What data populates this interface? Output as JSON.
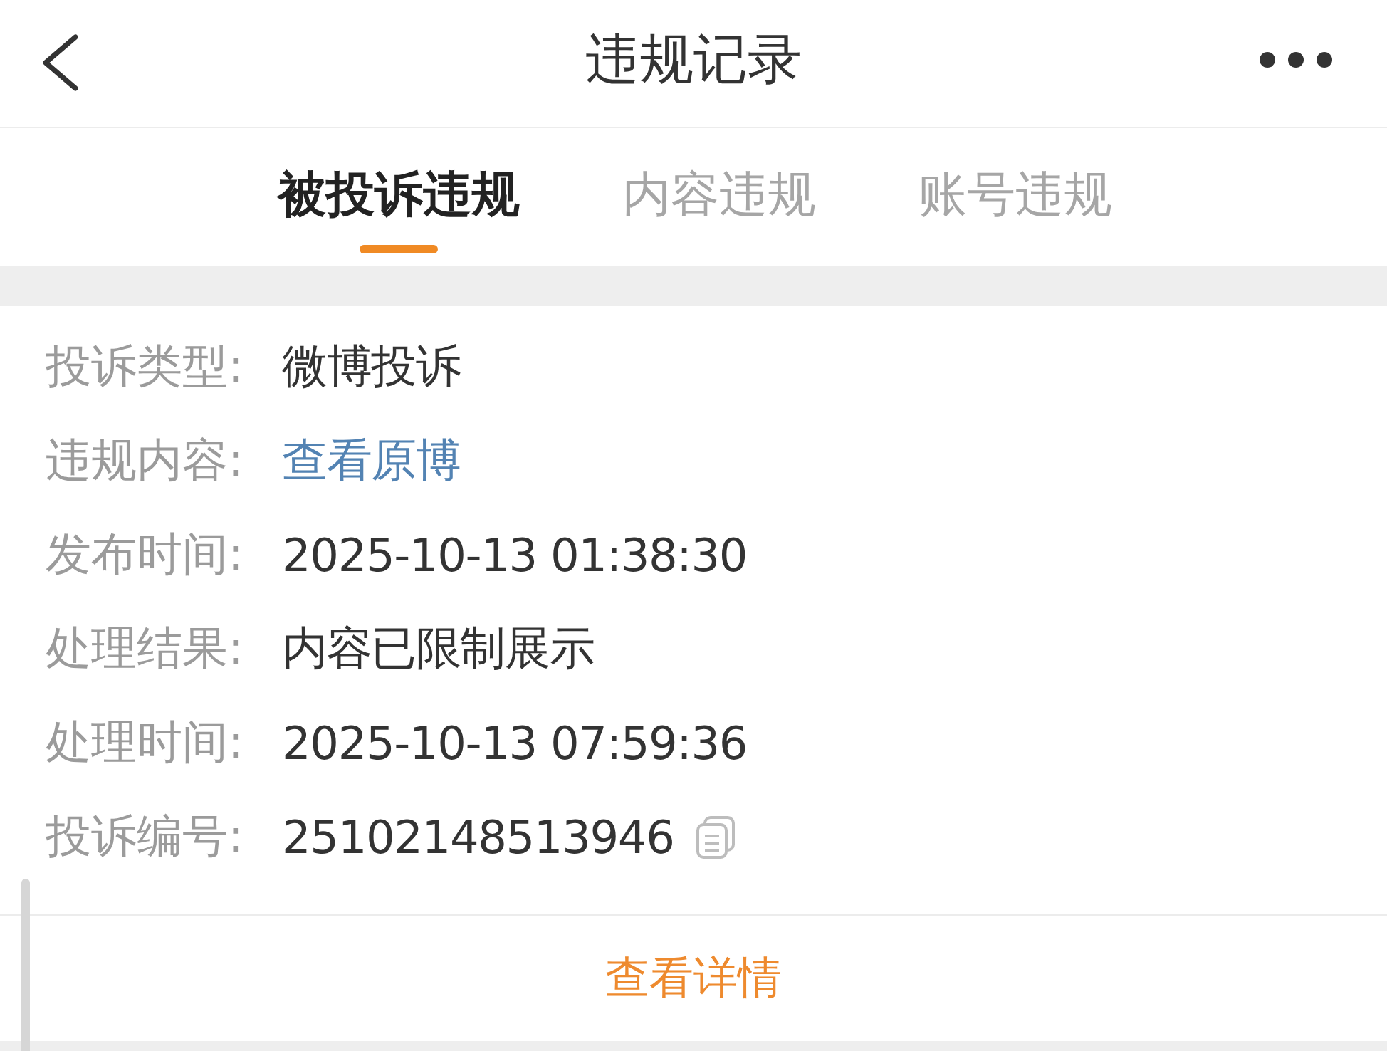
{
  "header": {
    "title": "违规记录"
  },
  "tabs": [
    {
      "label": "被投诉违规",
      "selected": true
    },
    {
      "label": "内容违规",
      "selected": false
    },
    {
      "label": "账号违规",
      "selected": false
    }
  ],
  "record": {
    "fields": [
      {
        "label": "投诉类型:",
        "value": "微博投诉",
        "kind": "text"
      },
      {
        "label": "违规内容:",
        "value": "查看原博",
        "kind": "link"
      },
      {
        "label": "发布时间:",
        "value": "2025-10-13 01:38:30",
        "kind": "text"
      },
      {
        "label": "处理结果:",
        "value": "内容已限制展示",
        "kind": "text"
      },
      {
        "label": "处理时间:",
        "value": "2025-10-13 07:59:36",
        "kind": "text"
      },
      {
        "label": "投诉编号:",
        "value": "25102148513946",
        "kind": "copyable"
      }
    ],
    "action": "查看详情"
  }
}
